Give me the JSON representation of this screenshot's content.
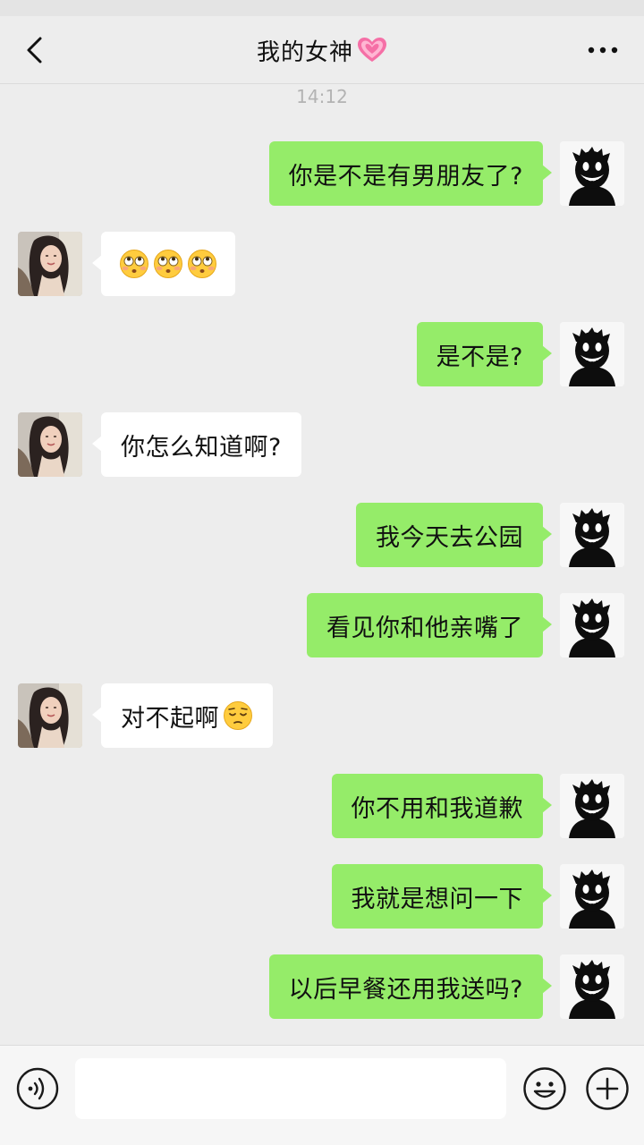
{
  "header": {
    "title": "我的女神",
    "back_icon": "chevron-left-icon",
    "title_icon": "heart-icon",
    "more_icon": "more-dots-icon"
  },
  "timestamp": "14:12",
  "messages": [
    {
      "sender": "me",
      "text": "你是不是有男朋友了?"
    },
    {
      "sender": "contact",
      "text": "",
      "emojis": [
        "flushed-face-emoji",
        "flushed-face-emoji",
        "flushed-face-emoji"
      ]
    },
    {
      "sender": "me",
      "text": "是不是?"
    },
    {
      "sender": "contact",
      "text": "你怎么知道啊?"
    },
    {
      "sender": "me",
      "text": "我今天去公园"
    },
    {
      "sender": "me",
      "text": "看见你和他亲嘴了"
    },
    {
      "sender": "contact",
      "text": "对不起啊",
      "emojis": [
        "pensive-face-emoji"
      ]
    },
    {
      "sender": "me",
      "text": "你不用和我道歉"
    },
    {
      "sender": "me",
      "text": "我就是想问一下"
    },
    {
      "sender": "me",
      "text": "以后早餐还用我送吗?"
    }
  ],
  "input_bar": {
    "voice_icon": "voice-icon",
    "text_value": "",
    "emoji_icon": "emoji-icon",
    "plus_icon": "plus-icon"
  },
  "colors": {
    "background": "#ededed",
    "my_bubble": "#95ec69",
    "contact_bubble": "#ffffff",
    "timestamp": "#b3b3b3"
  }
}
